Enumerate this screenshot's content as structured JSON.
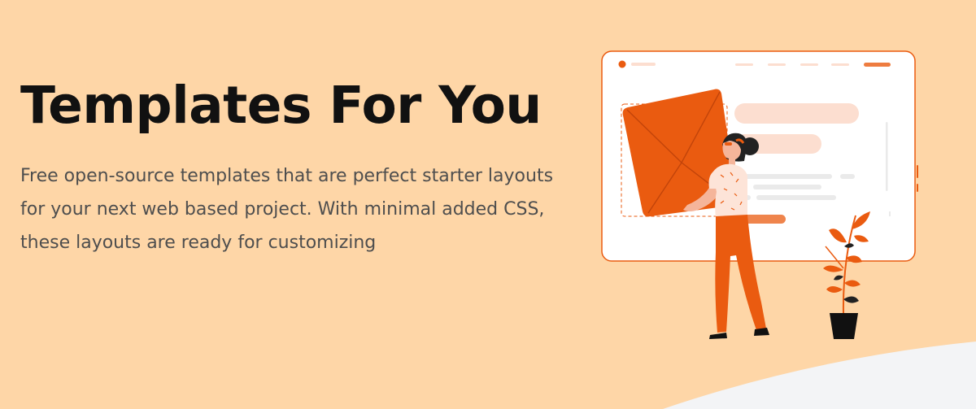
{
  "hero": {
    "title": "Templates For You",
    "subtitle": "Free open-source templates that are perfect starter layouts for your next web based project. With minimal added CSS, these layouts are ready for customizing"
  },
  "colors": {
    "background": "#fed6a7",
    "accent": "#ea5b10",
    "accent_light": "#fcded0",
    "title": "#111111",
    "subtitle": "#4e4e4e",
    "bottom_curve": "#f3f4f6"
  },
  "illustration": {
    "subject": "person-carrying-layout-card-beside-browser-mockup"
  }
}
